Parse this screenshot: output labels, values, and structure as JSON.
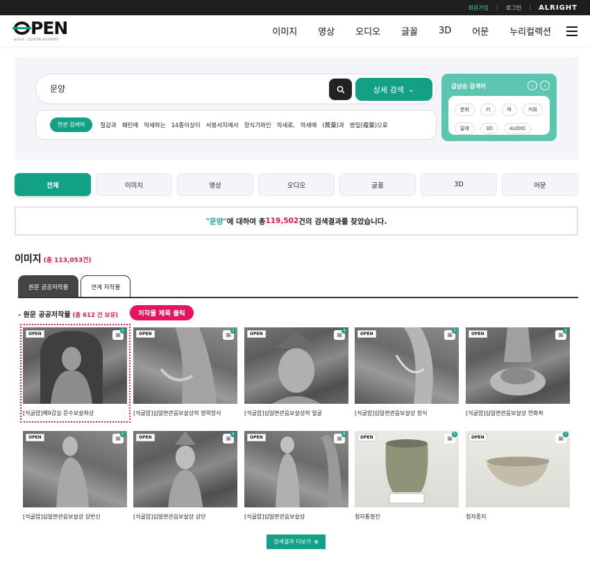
{
  "topbar": {
    "join": "회원가입",
    "login": "로그인",
    "brand": "ALRIGHT"
  },
  "logo": {
    "text": "PEN",
    "subtitle": "공공누리 · 공공저작물 자유이용허락"
  },
  "nav": [
    "이미지",
    "영상",
    "오디오",
    "글꼴",
    "3D",
    "어문",
    "누리컬렉션"
  ],
  "search": {
    "query": "문양",
    "advanced_label": "상세 검색",
    "related_label": "연관 검색어",
    "related": [
      "질감과",
      "패턴에",
      "막새와는",
      "14종이상이",
      "서봉서지에서",
      "장식기와인",
      "막새로,",
      "막새에",
      "(葺葉)과",
      "쌍잎(複葉)으로"
    ]
  },
  "rising": {
    "title": "급상승 검색어",
    "keywords": [
      "문화",
      "키",
      "락",
      "키위",
      "달래",
      "3D",
      "AUDIO"
    ]
  },
  "tabs": [
    "전체",
    "이미지",
    "영상",
    "오디오",
    "글꼴",
    "3D",
    "어문"
  ],
  "result": {
    "keyword": "\"문양\"",
    "pre": "에 대하여 총 ",
    "count": "119,502",
    "post": "건의 검색결과를 찾았습니다."
  },
  "section": {
    "title": "이미지",
    "count": "(총 113,053건)",
    "subtabs": [
      "원문 공공저작물",
      "연계 저작물"
    ],
    "group_title": "- 원문 공공저작물",
    "group_count": "(총 612 건 보유)",
    "click_badge": "저작물 제목 클릭"
  },
  "items": [
    {
      "title": "[석굴암]제9감실 문수보살좌상",
      "badge": "5"
    },
    {
      "title": "[석굴암]십일면관음보살상의 영락장식",
      "badge": "2"
    },
    {
      "title": "[석굴암]십일면관음보살상의 얼굴",
      "badge": "3"
    },
    {
      "title": "[석굴암]십일면관음보살상 장식",
      "badge": "3"
    },
    {
      "title": "[석굴암]십일면관음보살상 연화좌",
      "badge": "3"
    },
    {
      "title": "[석굴암]십일면관음보살상 상반신",
      "badge": "2"
    },
    {
      "title": "[석굴암]십일면관음보살상 상단",
      "badge": "3"
    },
    {
      "title": "[석굴암]십일면관음보살상",
      "badge": "6"
    },
    {
      "title": "청자통형잔",
      "badge": "5"
    },
    {
      "title": "청자종지",
      "badge": "2"
    }
  ],
  "thumb_label": "OPEN",
  "more_label": "검색결과 더보기"
}
